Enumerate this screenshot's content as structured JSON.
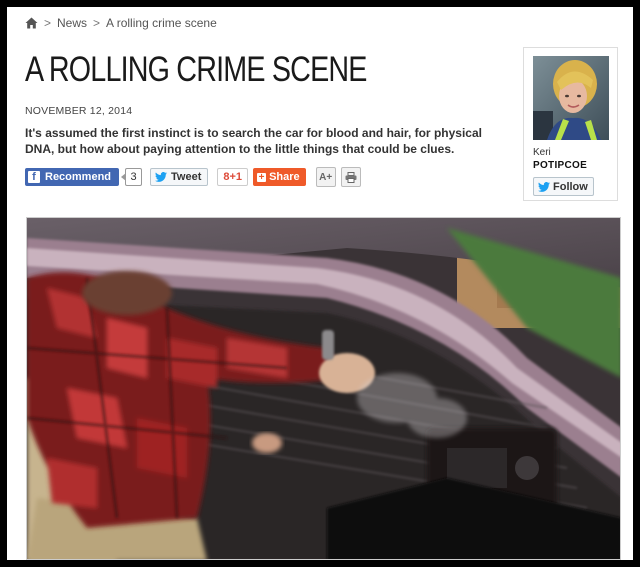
{
  "breadcrumb": {
    "home_icon": "home-icon",
    "separator": ">",
    "items": [
      "News",
      "A rolling crime scene"
    ]
  },
  "article": {
    "title": "A ROLLING CRIME SCENE",
    "date": "NOVEMBER 12, 2014",
    "summary": "It's assumed the first instinct is to search the car for blood and hair, for physical DNA, but how about paying attention to the little things that could be clues."
  },
  "share": {
    "recommend_label": "Recommend",
    "recommend_count": "3",
    "tweet_label": "Tweet",
    "gplus_label": "8+1",
    "share_label": "Share",
    "font_size_label": "A+",
    "print_icon": "print-icon"
  },
  "author": {
    "first_name": "Keri",
    "last_name": "POTIPCOE",
    "follow_label": "Follow"
  },
  "colors": {
    "facebook": "#4267b2",
    "share_orange": "#ef5a29",
    "gplus_red": "#dd4b39",
    "twitter_blue": "#1da1f2"
  }
}
